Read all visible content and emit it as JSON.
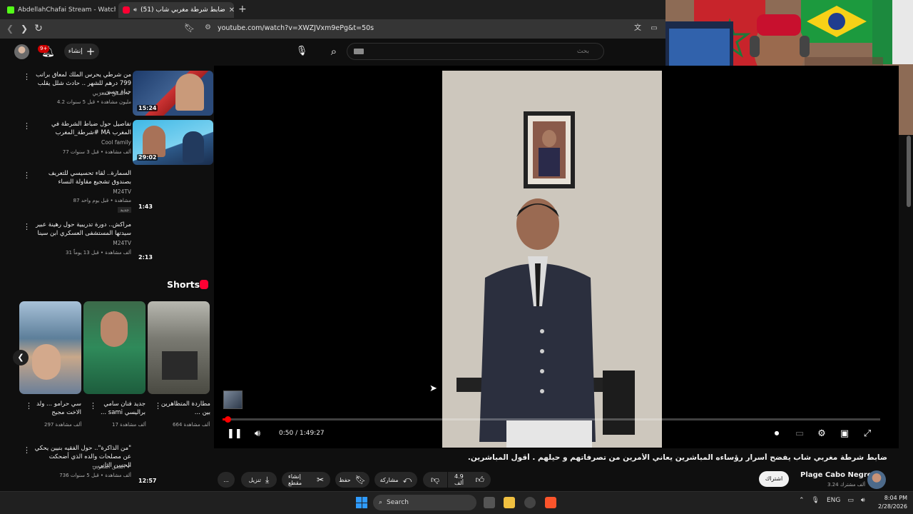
{
  "browser": {
    "tabs": [
      {
        "label": "AbdellahChafai Stream - Watch Live :",
        "active": false
      },
      {
        "label": "(51) ضابط شرطة مغربي شاب",
        "active": true
      }
    ],
    "url": "youtube.com/watch?v=XWZJVxm9ePg&t=50s"
  },
  "header": {
    "notification_count": "9+",
    "create_label": "إنشاء",
    "search_placeholder": "بحث"
  },
  "sidebar": {
    "videos": [
      {
        "title": "من شرطي يحرس الملك لمعاق براتب 799 درهم للشهر .. حادث شلل يقلب حياة حسن...",
        "channel": "المعق المغربي",
        "meta": "4.2 مليون مشاهدة • قبل 5 سنوات",
        "duration": "15:24",
        "verified": true
      },
      {
        "title": "تفاصيل حول ضباط الشرطة في المغرب MA #شرطة_المغرب",
        "channel": "Cool family",
        "meta": "77 ألف مشاهدة • قبل 3 سنوات",
        "duration": "29:02",
        "verified": false
      },
      {
        "title": "السمارة.. لقاء تحسيسي للتعريف بصندوق تشجيع مقاولة النساء",
        "channel": "M24TV",
        "meta": "87 مشاهدة • قبل يوم واحد",
        "duration": "1:43",
        "badge": "جديد"
      },
      {
        "title": "مراكش.. دورة تدريبية حول رهينة عبير سيدتها المستشفى العسكري ابن سينا",
        "channel": "M24TV",
        "meta": "31 ألف مشاهدة • قبل 13 يوماً",
        "duration": "2:13"
      },
      {
        "title": "\"من الذاكرة\".. حول الفقيه بنيين يحكي عن مصلحات والده الذي أضحكت الحسن الثاني...",
        "channel": "المعق المغربي",
        "meta": "736 ألف مشاهدة • قبل 5 سنوات",
        "duration": "12:57",
        "verified": true
      }
    ],
    "shorts_title": "Shorts",
    "shorts": [
      {
        "title": "سي حرامو ... ولد الاخت مجيح",
        "views": "297 ألف مشاهدة"
      },
      {
        "title": "جديد فنان سامي براليسي sami ...",
        "views": "17 ألف مشاهدة"
      },
      {
        "title": "مطاردة المتظاهرين بين ...",
        "views": "664 ألف مشاهدة"
      }
    ]
  },
  "player": {
    "time": "0:50 / 1:49:27",
    "progress_fraction": 0.0076
  },
  "video": {
    "title": "ضابط شرطة مغربي شاب يفضح أسرار رؤساءه المباشرين يعاني الأمرين من تصرفاتهم و حيلهم . أقول المباشرين.",
    "channel_name": "Plage Cabo Negro",
    "channel_subs": "3.24 ألف مشترك",
    "subscribe_label": "اشتراك",
    "like_count": "4.9 ألف",
    "share_label": "مشاركة",
    "save_label": "حفظ",
    "clip_label": "إنشاء مقطع",
    "download_label": "تنزيل",
    "more_label": "..."
  },
  "taskbar": {
    "search_label": "Search",
    "language": "ENG",
    "time": "8:04 PM",
    "date": "2/28/2026"
  }
}
